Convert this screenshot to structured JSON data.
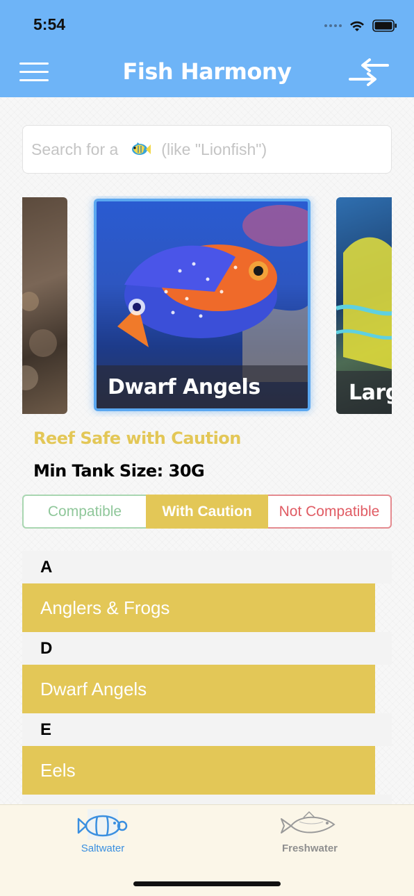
{
  "status_bar": {
    "time": "5:54"
  },
  "header": {
    "title": "Fish Harmony",
    "menu_icon": "hamburger-menu-icon",
    "swap_icon": "swap-arrows-icon"
  },
  "search": {
    "placeholder_prefix": "Search for a",
    "placeholder_suffix": "(like \"Lionfish\")",
    "icon": "fish-icon"
  },
  "carousel": {
    "cards": [
      {
        "label": ""
      },
      {
        "label": "Dwarf Angels"
      },
      {
        "label": "Larg"
      }
    ]
  },
  "details": {
    "reef_status": "Reef Safe with Caution",
    "min_tank_size": "Min Tank Size: 30G"
  },
  "filter": {
    "options": [
      "Compatible",
      "With Caution",
      "Not Compatible"
    ],
    "selected": "With Caution"
  },
  "list": {
    "sections": [
      {
        "letter": "A",
        "items": [
          "Anglers & Frogs"
        ]
      },
      {
        "letter": "D",
        "items": [
          "Dwarf Angels"
        ]
      },
      {
        "letter": "E",
        "items": [
          "Eels"
        ]
      }
    ]
  },
  "tabbar": {
    "tabs": [
      {
        "label": "Saltwater",
        "icon": "clownfish-icon",
        "active": true
      },
      {
        "label": "Freshwater",
        "icon": "freshwater-fish-icon",
        "active": false
      }
    ]
  },
  "colors": {
    "header_blue": "#6eb4f7",
    "caution_gold": "#e3c757",
    "compatible_green": "#8fc79a",
    "not_compatible_red": "#e05b63",
    "active_tab_blue": "#3a8fe0"
  }
}
